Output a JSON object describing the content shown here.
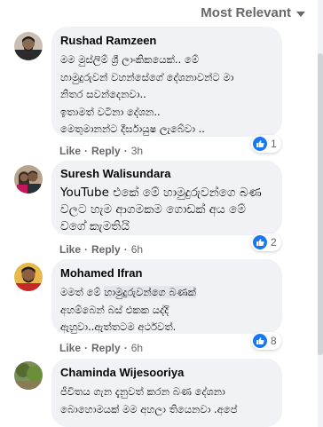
{
  "sort": {
    "label": "Most Relevant"
  },
  "action_labels": {
    "like": "Like",
    "reply": "Reply",
    "sep": "·"
  },
  "colors": {
    "like_blue": "#1877f2",
    "bubble_bg": "#f0f2f5",
    "meta_gray": "#65676b"
  },
  "comments": [
    {
      "author": "Rushad Ramzeen",
      "text": "මම මුස්ලිම් ශ්‍රී ලාංකිකයෙක්.. මේ\nහාමුදුරුවන් වහන්සේගේ දේශනාවන්ට මා\nනිතර සවන්දෙනවා..\nඉතාමත් වටිනා දේශන..\nමෙතුමානන්ට දීර්ඝායුෂ ලැබේවා ..",
      "time": "3h",
      "reactions": "1",
      "avatar_icon": "user-photo-icon"
    },
    {
      "author": "Suresh Walisundara",
      "text": "YouTube එකේ මේ හාමුදුරුවන්ගෙ බණ\nවලට හැම ආගමකම ගොඩක් අය මේ\nවගේ කැමතියි",
      "time": "6h",
      "reactions": "2",
      "avatar_icon": "couple-photo-icon"
    },
    {
      "author": "Mohamed Ifran",
      "text_pre": "මමත් මේ ",
      "text_hl": "හාමුදුරුවන්ගෙ බණක්",
      "text_post": "\nඅහම්බෙන් බස් එකක යද්දි\nඇහුවා..ඇත්තටම අර්ථවත්.",
      "time": "6h",
      "reactions": "8",
      "avatar_icon": "user-photo-icon"
    },
    {
      "author": "Chaminda Wijesooriya",
      "text": "ජීවිතය ගැන දැනුවත් කරන බණ දේශනා\nබොහොමයක් මම අහලා තියෙනවා .අපේ",
      "avatar_icon": "nature-photo-icon"
    }
  ]
}
